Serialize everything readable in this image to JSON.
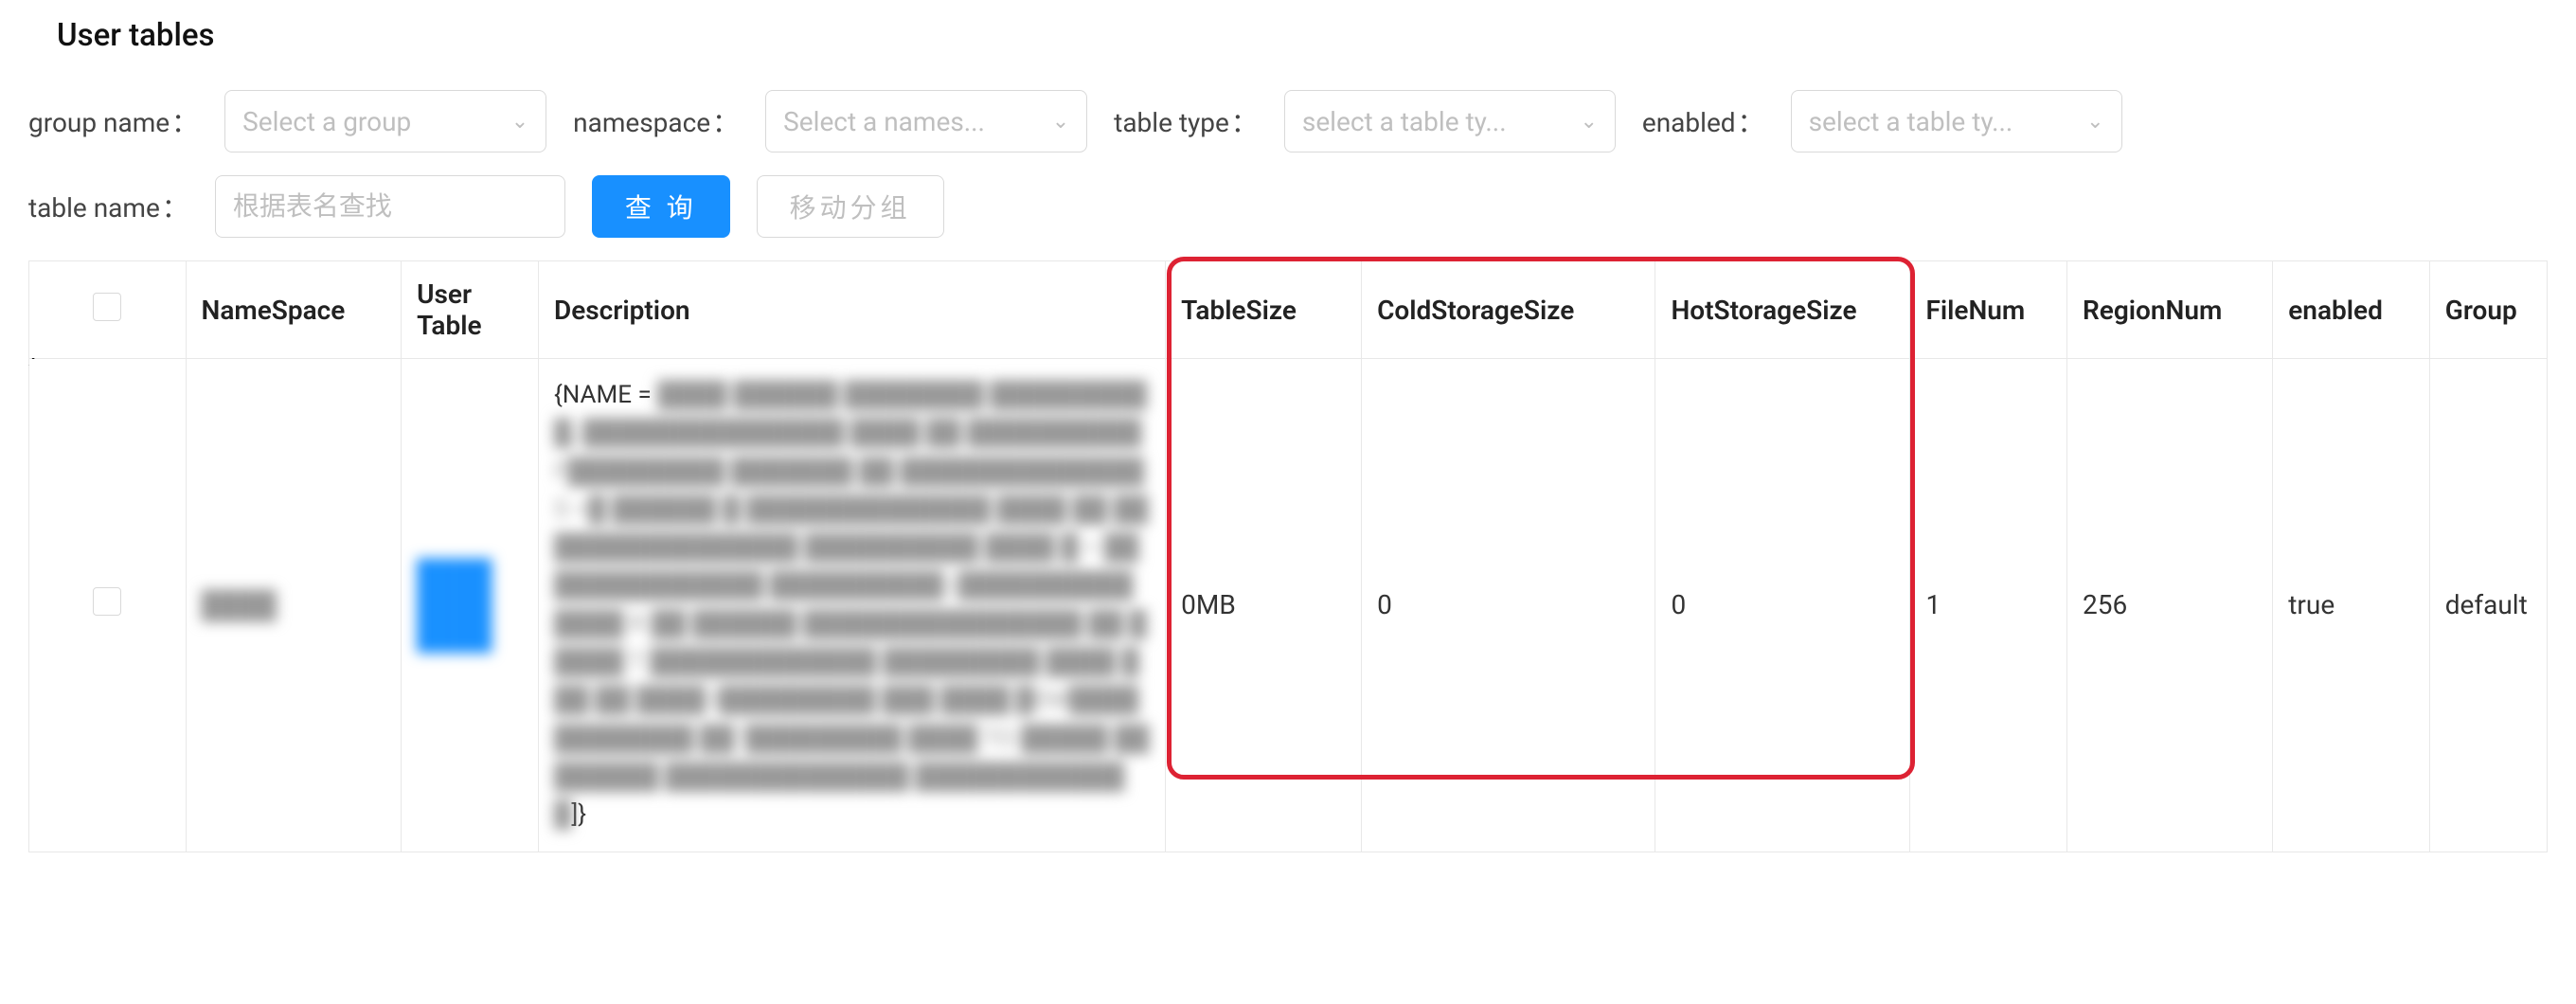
{
  "header": {
    "title": "User tables"
  },
  "filters": {
    "group": {
      "label": "group name",
      "placeholder": "Select a group"
    },
    "namespace": {
      "label": "namespace",
      "placeholder": "Select a names..."
    },
    "tableType": {
      "label": "table type",
      "placeholder": "select a table ty..."
    },
    "enabled": {
      "label": "enabled",
      "placeholder": "select a table ty..."
    },
    "tableName": {
      "label": "table name",
      "placeholder": "根据表名查找"
    },
    "searchBtn": "查 询",
    "moveGroupBtn": "移动分组"
  },
  "table": {
    "columns": {
      "namespace": "NameSpace",
      "userTable": "User Table",
      "description": "Description",
      "tableSize": "TableSize",
      "coldStorageSize": "ColdStorageSize",
      "hotStorageSize": "HotStorageSize",
      "fileNum": "FileNum",
      "regionNum": "RegionNum",
      "enabled": "enabled",
      "group": "Group"
    },
    "rows": [
      {
        "namespace": "████",
        "userTable": "████ ████ ████",
        "descriptionPrefix": "{NAME =",
        "descriptionSuffix": "]}",
        "tableSize": "0MB",
        "coldStorageSize": "0",
        "hotStorageSize": "0",
        "fileNum": "1",
        "regionNum": "256",
        "enabled": "true",
        "group": "default"
      }
    ]
  }
}
